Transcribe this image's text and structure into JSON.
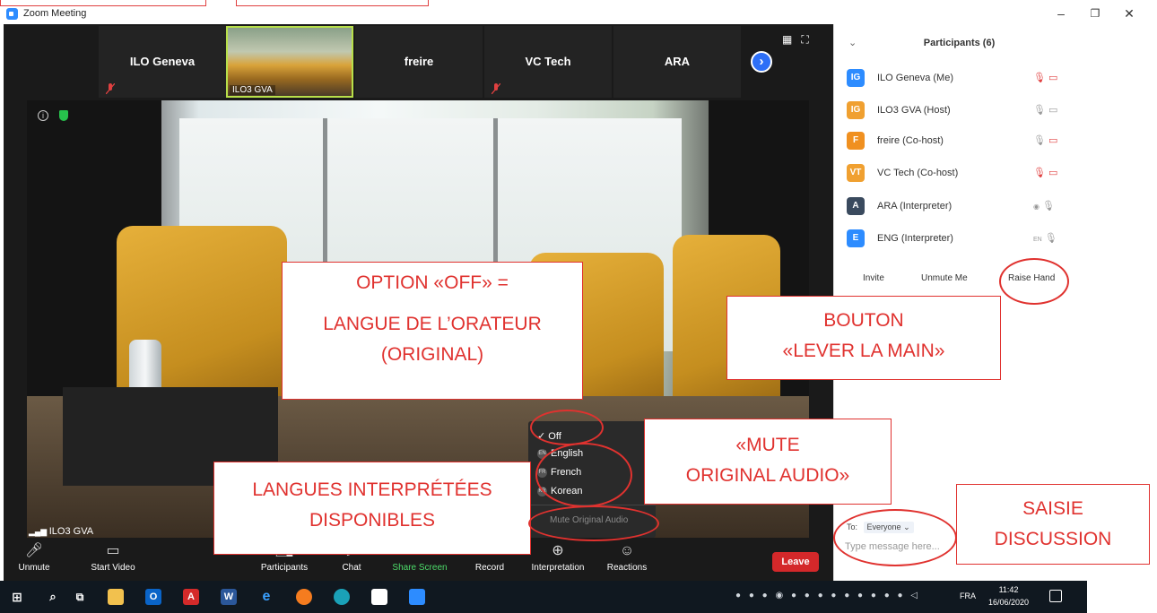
{
  "window": {
    "title": "Zoom Meeting"
  },
  "strip": {
    "tiles": [
      "ILO Geneva",
      "freire",
      "VC Tech",
      "ARA"
    ],
    "photo_tile": "ILO3 GVA",
    "next_icon": "chevron-right-icon"
  },
  "video": {
    "speaker_label": "ILO3 GVA"
  },
  "toolbar": {
    "unmute": "Unmute",
    "start_video": "Start Video",
    "participants": "Participants",
    "chat": "Chat",
    "share_screen": "Share Screen",
    "record": "Record",
    "interpretation": "Interpretation",
    "reactions": "Reactions",
    "leave": "Leave"
  },
  "interpretation_menu": {
    "off": "Off",
    "languages": [
      {
        "code": "EN",
        "label": "English"
      },
      {
        "code": "FR",
        "label": "French"
      },
      {
        "code": "KR",
        "label": "Korean"
      }
    ],
    "mute_original": "Mute Original Audio"
  },
  "panel": {
    "title": "Participants (6)",
    "participants": [
      {
        "initials": "IG",
        "name": "ILO Geneva (Me)",
        "color": "#2d8cff"
      },
      {
        "initials": "IG",
        "name": "ILO3 GVA (Host)",
        "color": "#f0a030"
      },
      {
        "initials": "F",
        "name": "freire (Co-host)",
        "color": "#f09020"
      },
      {
        "initials": "VT",
        "name": "VC Tech (Co-host)",
        "color": "#f0a030"
      },
      {
        "initials": "A",
        "name": "ARA (Interpreter)",
        "color": "#3a4a5e"
      },
      {
        "initials": "E",
        "name": "ENG (Interpreter)",
        "color": "#2d8cff"
      }
    ],
    "interpreter_badges": [
      "EN"
    ],
    "invite": "Invite",
    "unmute_me": "Unmute Me",
    "raise_hand": "Raise Hand",
    "chat_to_label": "To:",
    "chat_to_value": "Everyone",
    "chat_placeholder": "Type message here..."
  },
  "annotations": {
    "off_option": [
      "OPTION «OFF» =",
      "LANGUE DE L’ORATEUR",
      "(ORIGINAL)"
    ],
    "raise_hand": [
      "BOUTON",
      "«LEVER LA MAIN»"
    ],
    "mute_original": [
      "«MUTE",
      "ORIGINAL AUDIO»"
    ],
    "languages": [
      "LANGUES INTERPRÉTÉES",
      "DISPONIBLES"
    ],
    "chat": [
      "SAISIE",
      "DISCUSSION"
    ]
  },
  "taskbar": {
    "lang": "FRA",
    "time": "11:42",
    "date": "16/06/2020"
  }
}
